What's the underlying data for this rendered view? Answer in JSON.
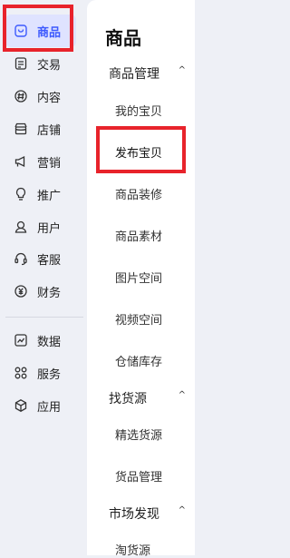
{
  "primary_nav": {
    "items": [
      {
        "label": "商品",
        "icon": "goods-icon"
      },
      {
        "label": "交易",
        "icon": "trade-icon"
      },
      {
        "label": "内容",
        "icon": "content-icon"
      },
      {
        "label": "店铺",
        "icon": "shop-icon"
      },
      {
        "label": "营销",
        "icon": "marketing-icon"
      },
      {
        "label": "推广",
        "icon": "promotion-icon"
      },
      {
        "label": "用户",
        "icon": "user-icon"
      },
      {
        "label": "客服",
        "icon": "customer-service-icon"
      },
      {
        "label": "财务",
        "icon": "finance-icon"
      },
      {
        "label": "数据",
        "icon": "data-icon"
      },
      {
        "label": "服务",
        "icon": "service-icon"
      },
      {
        "label": "应用",
        "icon": "app-icon"
      }
    ],
    "active_index": 0
  },
  "secondary_nav": {
    "title": "商品",
    "groups": [
      {
        "label": "商品管理",
        "caret": "^",
        "items": [
          "我的宝贝",
          "发布宝贝",
          "商品装修",
          "商品素材",
          "图片空间",
          "视频空间",
          "仓储库存"
        ]
      },
      {
        "label": "找货源",
        "caret": "^",
        "items": [
          "精选货源",
          "货品管理"
        ]
      },
      {
        "label": "市场发现",
        "caret": "^",
        "items": [
          "淘货源"
        ]
      }
    ]
  },
  "colors": {
    "accent": "#3d5afe",
    "highlight": "#e8232b",
    "sidebar_bg": "#eef0f6"
  }
}
